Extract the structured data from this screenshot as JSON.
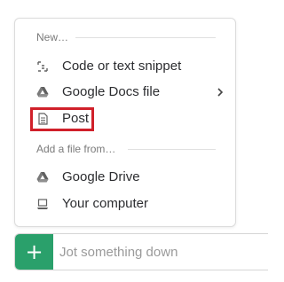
{
  "menu": {
    "new_header": "New…",
    "new_items": [
      {
        "label": "Code or text snippet",
        "icon": "snippet-icon"
      },
      {
        "label": "Google Docs file",
        "icon": "google-drive-icon",
        "has_submenu": true
      },
      {
        "label": "Post",
        "icon": "post-document-icon",
        "highlighted": true
      }
    ],
    "add_header": "Add a file from…",
    "add_items": [
      {
        "label": "Google Drive",
        "icon": "google-drive-icon"
      },
      {
        "label": "Your computer",
        "icon": "laptop-icon"
      }
    ]
  },
  "composer": {
    "add_button_label": "+",
    "placeholder": "Jot something down"
  },
  "colors": {
    "accent_green": "#2aa06b",
    "highlight_red": "#d0202a",
    "text": "#2c2d30",
    "muted": "#7a7a7a"
  }
}
